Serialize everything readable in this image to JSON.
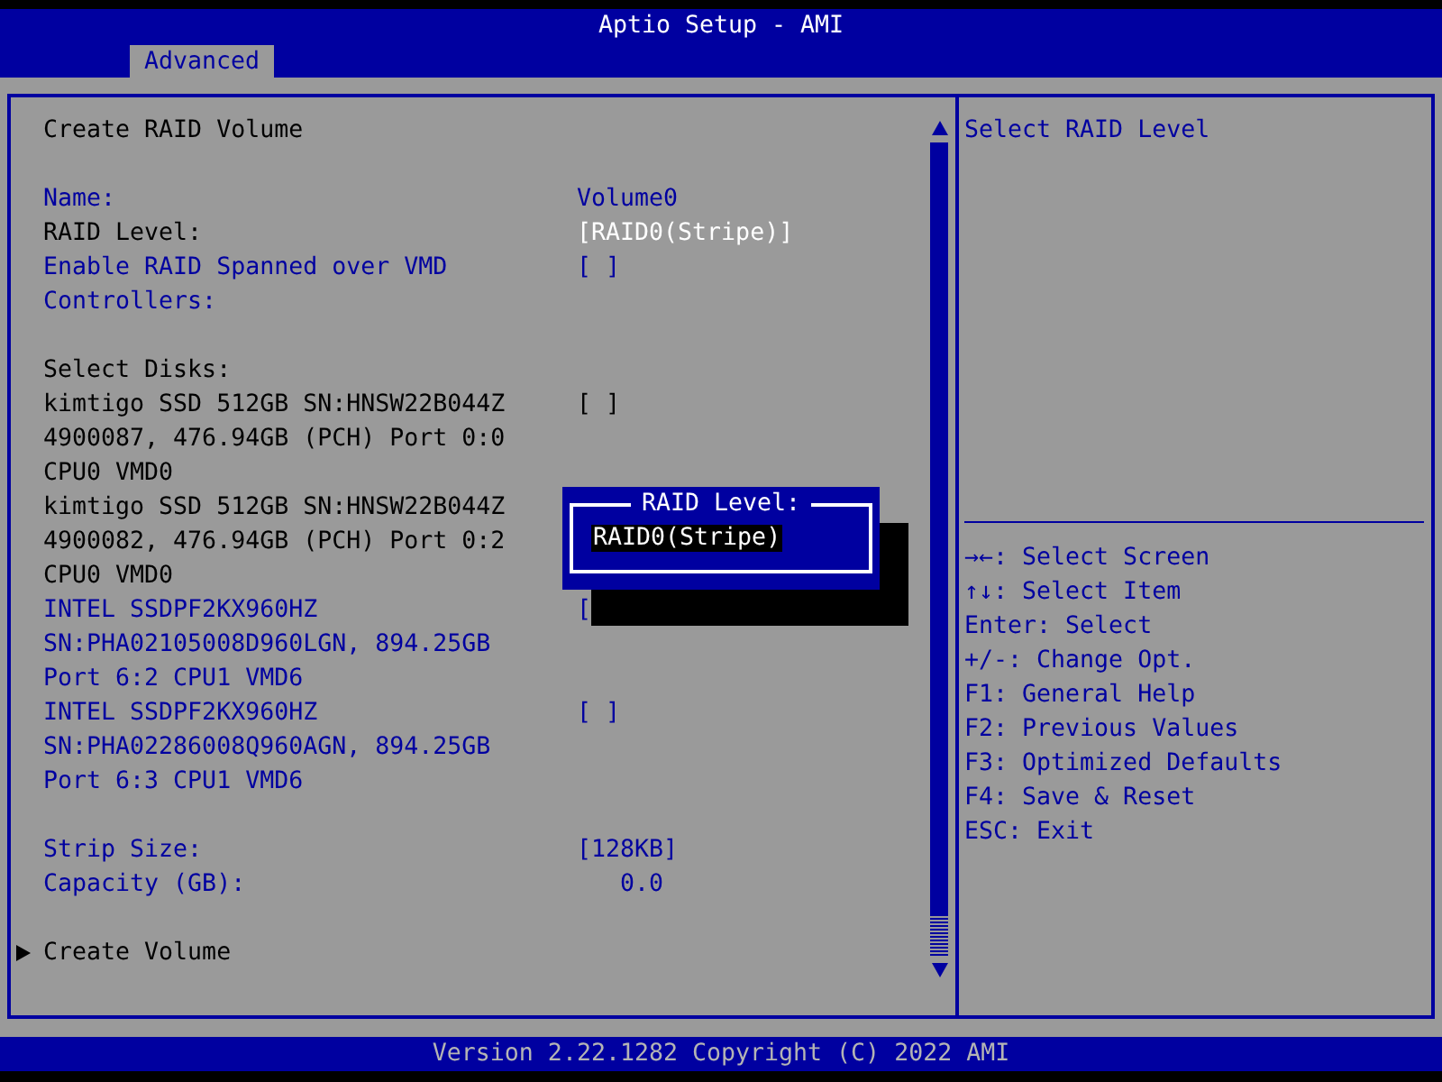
{
  "window": {
    "title": "Aptio Setup - AMI"
  },
  "tabs": [
    {
      "label": "Advanced",
      "selected": true
    }
  ],
  "sections": [
    [
      {
        "kind": "heading",
        "lines": [
          "Create RAID Volume"
        ]
      }
    ],
    [
      {
        "kind": "option",
        "lines": [
          "Name:"
        ],
        "value": "Volume0",
        "selected": false,
        "disabled": false
      },
      {
        "kind": "option",
        "lines": [
          "RAID Level:"
        ],
        "value": "[RAID0(Stripe)]",
        "selected": true,
        "disabled": false
      },
      {
        "kind": "option",
        "lines": [
          "Enable RAID Spanned over VMD",
          "Controllers:"
        ],
        "value": "[ ]",
        "selected": false,
        "disabled": false
      }
    ],
    [
      {
        "kind": "heading",
        "lines": [
          "Select Disks:"
        ]
      },
      {
        "kind": "option",
        "lines": [
          "kimtigo SSD 512GB SN:HNSW22B044Z",
          "4900087, 476.94GB (PCH) Port 0:0",
          "CPU0 VMD0"
        ],
        "value": "[ ]",
        "selected": false,
        "disabled": true
      },
      {
        "kind": "option",
        "lines": [
          "kimtigo SSD 512GB SN:HNSW22B044Z",
          "4900082, 476.94GB (PCH) Port 0:2",
          "CPU0 VMD0"
        ],
        "selected": false,
        "disabled": true
      },
      {
        "kind": "option",
        "lines": [
          "INTEL SSDPF2KX960HZ",
          "SN:PHA02105008D960LGN, 894.25GB",
          "Port 6:2 CPU1 VMD6"
        ],
        "value": "[",
        "selected": false,
        "disabled": false
      },
      {
        "kind": "option",
        "lines": [
          "INTEL SSDPF2KX960HZ",
          "SN:PHA02286008Q960AGN, 894.25GB",
          "Port 6:3 CPU1 VMD6"
        ],
        "value": "[ ]",
        "selected": false,
        "disabled": false
      }
    ],
    [
      {
        "kind": "option",
        "lines": [
          "Strip Size:"
        ],
        "value": "[128KB]",
        "selected": false,
        "disabled": false
      },
      {
        "kind": "readout",
        "lines": [
          "Capacity (GB):"
        ],
        "value": "0.0"
      }
    ],
    [
      {
        "kind": "submenu",
        "lines": [
          "Create Volume"
        ]
      }
    ]
  ],
  "help": {
    "text": "Select RAID Level",
    "keys": [
      "→←: Select Screen",
      "↑↓: Select Item",
      "Enter: Select",
      "+/-: Change Opt.",
      "F1: General Help",
      "F2: Previous Values",
      "F3: Optimized Defaults",
      "F4: Save & Reset",
      "ESC: Exit"
    ]
  },
  "popup": {
    "title": "RAID Level:",
    "options": [
      {
        "label": "RAID0(Stripe)",
        "selected": true
      }
    ]
  },
  "status_bar": "Version 2.22.1282 Copyright (C) 2022 AMI"
}
